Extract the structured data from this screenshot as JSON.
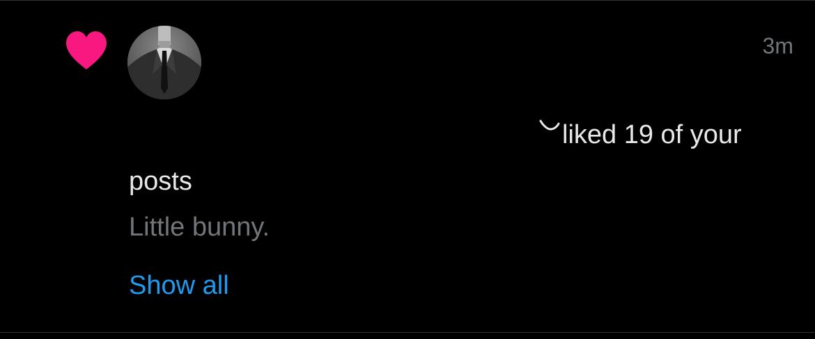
{
  "notification": {
    "timestamp": "3m",
    "action_text": "liked 19 of your",
    "action_text_cont": "posts",
    "post_preview": "Little bunny.",
    "show_all_label": "Show all"
  },
  "icons": {
    "type_icon": "heart-icon",
    "user_avatar": "avatar",
    "name_glyph": "swoosh-icon"
  },
  "colors": {
    "background": "#000000",
    "heart": "#f91880",
    "primary_text": "#e7e9ea",
    "secondary_text": "#71767b",
    "link": "#1d9bf0"
  }
}
